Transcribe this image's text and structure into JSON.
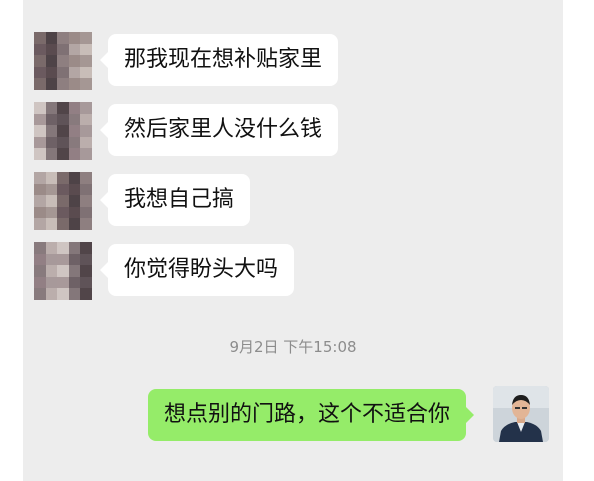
{
  "messages": [
    {
      "sender": "contact",
      "text": "那我现在想补贴家里"
    },
    {
      "sender": "contact",
      "text": "然后家里人没什么钱"
    },
    {
      "sender": "contact",
      "text": "我想自己搞"
    },
    {
      "sender": "contact",
      "text": "你觉得盼头大吗"
    }
  ],
  "timestamp": "9月2日 下午15:08",
  "reply": {
    "sender": "me",
    "text": "想点别的门路，这个不适合你"
  },
  "colors": {
    "chat_background": "#ededed",
    "incoming_bubble": "#ffffff",
    "outgoing_bubble": "#95ec69",
    "timestamp_text": "#8c8c8c"
  },
  "icons": {
    "contact_avatar": "pixelated-avatar-icon",
    "my_avatar": "user-photo-avatar-icon"
  }
}
